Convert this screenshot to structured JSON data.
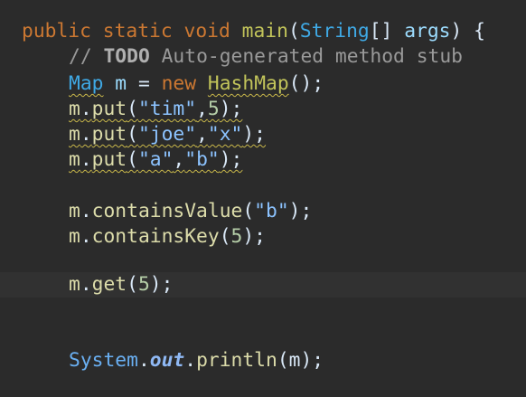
{
  "colors": {
    "background": "#2b2b2b",
    "current_line": "#313131",
    "keyword": "#cc7832",
    "method_decl": "#c2c45a",
    "type": "#3fa9e5",
    "string": "#8cc3ff",
    "comment": "#9a9a9a",
    "warning_squiggle": "#c9b84a"
  },
  "lines": {
    "l1": {
      "kw_public": "public",
      "kw_static": "static",
      "kw_void": "void",
      "fn_main": "main",
      "paren_open": "(",
      "type_string": "String",
      "brackets": "[]",
      "param": "args",
      "tail": ") {"
    },
    "l2": {
      "slashes": "//",
      "todo": "TODO",
      "text": "Auto-generated method stub"
    },
    "l3": {
      "type_map": "Map",
      "var_m": "m",
      "eq": "=",
      "kw_new": "new",
      "type_hashmap": "HashMap",
      "tail": "();"
    },
    "l4": {
      "recv": "m",
      "dot": ".",
      "method": "put",
      "open": "(",
      "arg1": "\"tim\"",
      "comma": ",",
      "arg2": "5",
      "close": ");"
    },
    "l5": {
      "recv": "m",
      "dot": ".",
      "method": "put",
      "open": "(",
      "arg1": "\"joe\"",
      "comma": ",",
      "arg2": "\"x\"",
      "close": ");"
    },
    "l6": {
      "recv": "m",
      "dot": ".",
      "method": "put",
      "open": "(",
      "arg1": "\"a\"",
      "comma": ",",
      "arg2": "\"b\"",
      "close": ");"
    },
    "l8": {
      "recv": "m",
      "dot": ".",
      "method": "containsValue",
      "open": "(",
      "arg": "\"b\"",
      "close": ");"
    },
    "l9": {
      "recv": "m",
      "dot": ".",
      "method": "containsKey",
      "open": "(",
      "arg": "5",
      "close": ");"
    },
    "l11": {
      "recv": "m",
      "dot": ".",
      "method": "get",
      "open": "(",
      "arg": "5",
      "close": ");"
    },
    "l14": {
      "cls": "System",
      "dot1": ".",
      "field": "out",
      "dot2": ".",
      "method": "println",
      "open": "(",
      "arg": "m",
      "close": ");"
    }
  }
}
